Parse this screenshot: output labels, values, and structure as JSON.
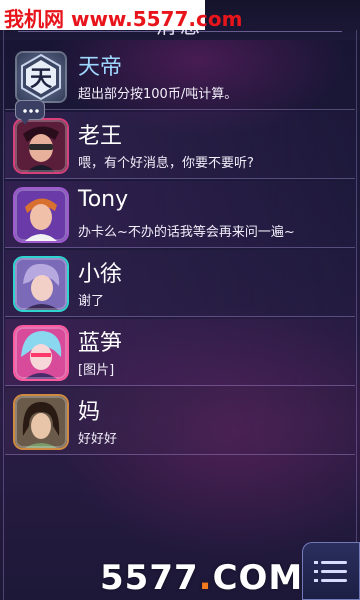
{
  "watermark": {
    "top_text": "我机网 www.5577.com",
    "bottom_prefix": "5577",
    "bottom_dot": ".",
    "bottom_suffix": "COM"
  },
  "header": {
    "title": "消息"
  },
  "contacts": [
    {
      "name": "天帝",
      "message": "超出部分按100币/吨计算。",
      "avatar_icon": "tiandi-logo-icon",
      "accent": "#4a5575"
    },
    {
      "name": "老王",
      "message": "喂，有个好消息，你要不要听?",
      "avatar_icon": "laowang-avatar",
      "accent": "#d8407a"
    },
    {
      "name": "Tony",
      "message": "办卡么~不办的话我等会再来问一遍~",
      "avatar_icon": "tony-avatar",
      "accent": "#a05ad0"
    },
    {
      "name": "小徐",
      "message": "谢了",
      "avatar_icon": "xiaoxu-avatar",
      "accent": "#2fd4d0"
    },
    {
      "name": "蓝笋",
      "message": "[图片]",
      "avatar_icon": "lansun-avatar",
      "accent": "#ff5aa0"
    },
    {
      "name": "妈",
      "message": "好好好",
      "avatar_icon": "mom-avatar",
      "accent": "#d08a40"
    }
  ],
  "menu_button": {
    "icon": "menu-list-icon"
  }
}
